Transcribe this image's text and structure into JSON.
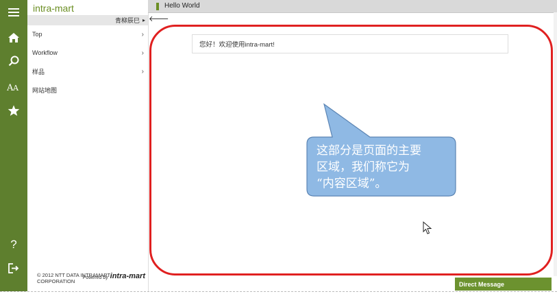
{
  "app": {
    "brand": "intra-mart"
  },
  "header": {
    "title": "Hello World"
  },
  "user": {
    "name": "青柳辰巳"
  },
  "rail": {
    "icons": [
      "menu-icon",
      "home-icon",
      "search-icon",
      "font-size-icon",
      "star-icon",
      "help-icon",
      "logout-icon"
    ]
  },
  "menu": {
    "items": [
      {
        "label": "Top",
        "has_children": true
      },
      {
        "label": "Workflow",
        "has_children": true
      },
      {
        "label": "样品",
        "has_children": true
      },
      {
        "label": "网站地图",
        "has_children": false
      }
    ]
  },
  "footer": {
    "powered_prefix": "Powered by",
    "powered_logo": "intra-mart",
    "copyright": "© 2012 NTT DATA INTRAMART CORPORATION"
  },
  "content": {
    "welcome": "您好！欢迎使用intra-mart!"
  },
  "callout": {
    "lines": [
      "这部分是页面的主要",
      "区域，我们称它为",
      "“内容区域”。"
    ]
  },
  "direct_message": {
    "label": "Direct Message"
  },
  "colors": {
    "brand_green": "#5e7f2e",
    "frame_red": "#e02020",
    "callout_blue": "#8fb9e4"
  }
}
